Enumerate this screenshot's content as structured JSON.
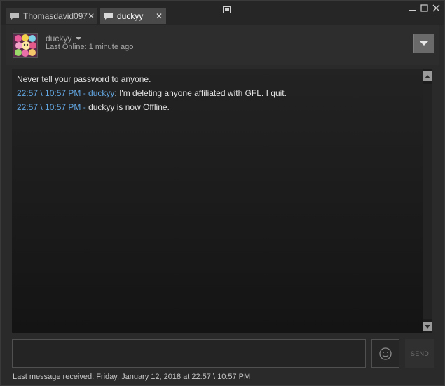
{
  "tabs": [
    {
      "label": "Thomasdavid097",
      "close": "✕",
      "active": false
    },
    {
      "label": "duckyy",
      "close": "✕",
      "active": true
    }
  ],
  "window_controls": {
    "minimize": "minimize-icon",
    "maximize": "maximize-icon",
    "close": "close-icon"
  },
  "header": {
    "username": "duckyy",
    "last_online": "Last Online: 1 minute ago"
  },
  "chat": {
    "warning": "Never tell your password to anyone.",
    "messages": [
      {
        "timestamp": "22:57 \\ 10:57 PM - duckyy",
        "separator": ": ",
        "text": "I'm deleting anyone affiliated with GFL. I quit."
      },
      {
        "timestamp": "22:57 \\ 10:57 PM - ",
        "separator": "",
        "text": "duckyy is now Offline."
      }
    ]
  },
  "input": {
    "value": "",
    "placeholder": ""
  },
  "send_label": "SEND",
  "status": "Last message received: Friday, January 12, 2018 at 22:57 \\ 10:57 PM",
  "colors": {
    "background": "#262626",
    "timestamp": "#62a7e3",
    "text": "#e4e4e4"
  }
}
